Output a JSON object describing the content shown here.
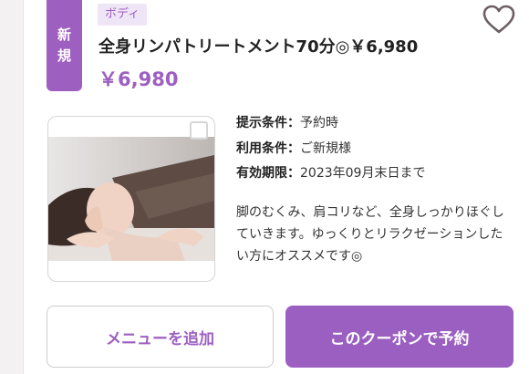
{
  "coupon": {
    "new_label_line1": "新",
    "new_label_line2": "規",
    "category": "ボディ",
    "title": "全身リンパトリートメント70分◎￥6,980",
    "price": "￥6,980",
    "conditions": [
      {
        "label": "提示条件：",
        "value": "予約時"
      },
      {
        "label": "利用条件：",
        "value": "ご新規様"
      },
      {
        "label": "有効期限：",
        "value": "2023年09月末日まで"
      }
    ],
    "description": "脚のむくみ、肩コリなど、全身しっかりほぐしていきます。ゆっくりとリラクゼーションしたい方にオススメです◎"
  },
  "buttons": {
    "add_menu": "メニューを追加",
    "reserve": "このクーポンで予約"
  },
  "icons": {
    "favorite": "heart-outline-icon",
    "select": "checkbox-icon"
  },
  "colors": {
    "accent": "#9d5fc0",
    "category_bg": "#eee6f6"
  }
}
